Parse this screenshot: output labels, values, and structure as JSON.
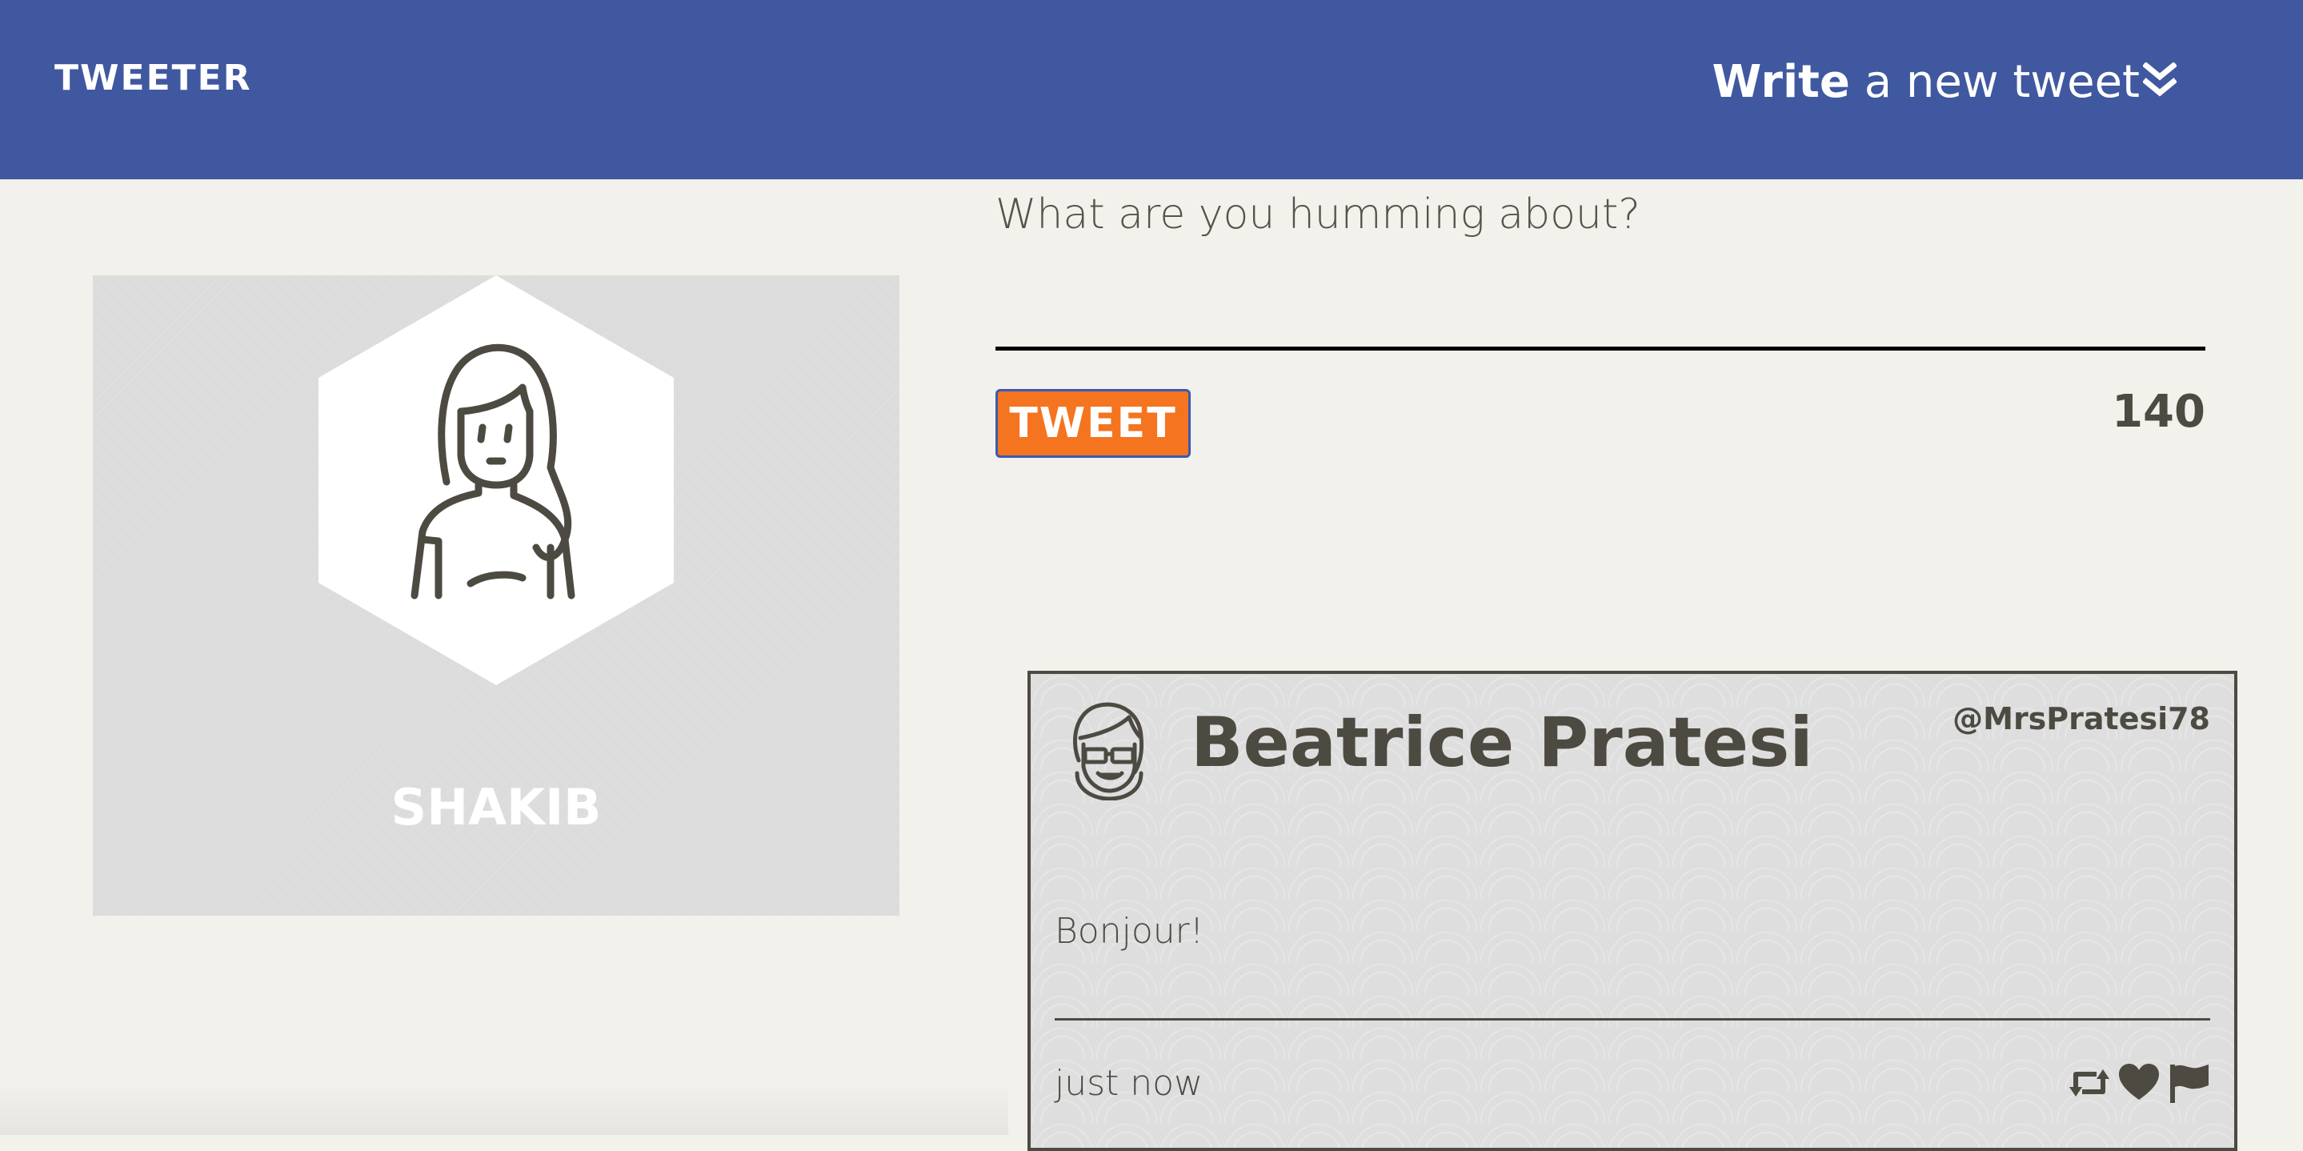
{
  "nav": {
    "logo": "TWEETER",
    "compose_bold": "Write",
    "compose_rest": " a new tweet",
    "compose_icon": "double-chevron-down-icon",
    "background": "#4058a0"
  },
  "profile": {
    "name": "SHAKIB",
    "avatar_icon": "woman-avatar-icon"
  },
  "composer": {
    "placeholder": "What are you humming about?",
    "value": "",
    "button_label": "TWEET",
    "counter": "140",
    "button_color": "#f47420"
  },
  "tweets": [
    {
      "author": "Beatrice Pratesi",
      "handle": "@MrsPratesi78",
      "body": "Bonjour!",
      "time": "just now",
      "avatar_icon": "woman-with-glasses-avatar-icon",
      "actions": [
        "retweet-icon",
        "heart-icon",
        "flag-icon"
      ]
    }
  ]
}
